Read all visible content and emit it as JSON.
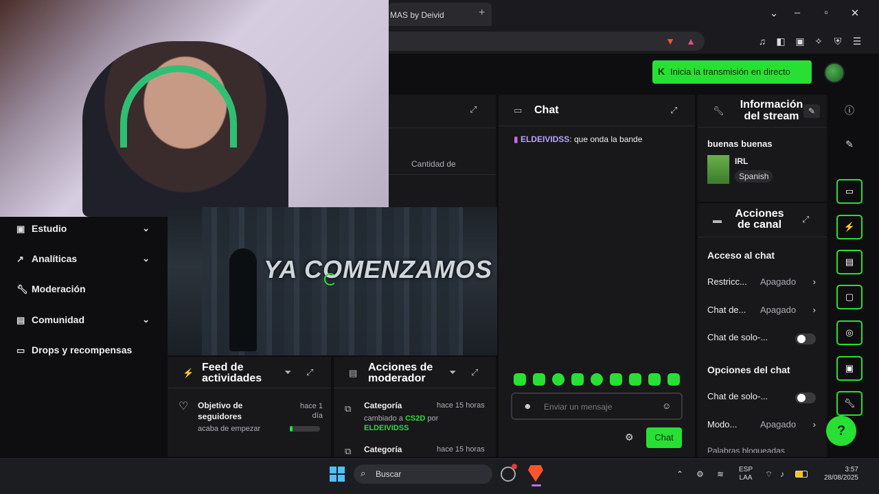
{
  "colors": {
    "accent": "#28e034",
    "bg": "#0e0e10",
    "panel": "#18181b"
  },
  "browser": {
    "tab_title": "MAS by Deivid",
    "new_tab_icon": "+",
    "window_controls": [
      "chevron-down-icon",
      "minimize-icon",
      "restore-icon",
      "close-icon"
    ]
  },
  "header": {
    "golive_label": "Inicia la transmisión en directo"
  },
  "stats": {
    "label_partial": "Cantidad de"
  },
  "nav": {
    "items": [
      {
        "label": "Estudio",
        "icon": "studio-icon",
        "has_chevron": true
      },
      {
        "label": "Analíticas",
        "icon": "analytics-icon",
        "has_chevron": true
      },
      {
        "label": "Moderación",
        "icon": "wrench-icon",
        "has_chevron": false
      },
      {
        "label": "Comunidad",
        "icon": "community-icon",
        "has_chevron": true
      },
      {
        "label": "Drops y recompensas",
        "icon": "gift-icon",
        "has_chevron": false
      }
    ]
  },
  "preview": {
    "overlay_text": "YA COMENZAMOS"
  },
  "feed": {
    "title": "Feed de actividades",
    "item_title": "Objetivo de seguidores",
    "item_sub": "acaba de empezar",
    "item_time": "hace 1 día",
    "progress": 0.1
  },
  "mod_actions": {
    "title": "Acciones de moderador",
    "items": [
      {
        "title": "Categoría",
        "time": "hace 15 horas",
        "desc": "cambiado a",
        "value": "CS2D",
        "by": "por",
        "user": "ELDEIVIDSS"
      },
      {
        "title": "Categoría",
        "time": "hace 15 horas"
      }
    ]
  },
  "chat": {
    "title": "Chat",
    "messages": [
      {
        "user": "ELDEIVIDSS",
        "text": ": que onda la bande"
      }
    ],
    "input_placeholder": "Enviar un mensaje",
    "send_label": "Chat"
  },
  "stream_info": {
    "title": "Información del stream",
    "stream_title": "buenas buenas",
    "category": "IRL",
    "language": "Spanish"
  },
  "channel_actions": {
    "title": "Acciones de canal",
    "section1": "Acceso al chat",
    "rows1": [
      {
        "label": "Restricc...",
        "value": "Apagado",
        "type": "arrow"
      },
      {
        "label": "Chat de...",
        "value": "Apagado",
        "type": "arrow"
      },
      {
        "label": "Chat de solo-...",
        "type": "toggle"
      }
    ],
    "section2": "Opciones del chat",
    "rows2": [
      {
        "label": "Chat de solo-...",
        "type": "toggle"
      },
      {
        "label": "Modo...",
        "value": "Apagado",
        "type": "arrow"
      }
    ],
    "cut_row": "Palabras bloqueadas"
  },
  "taskbar": {
    "search": "Buscar",
    "lang_top": "ESP",
    "lang_bottom": "LAA",
    "time": "3:57",
    "date": "28/08/2025"
  }
}
